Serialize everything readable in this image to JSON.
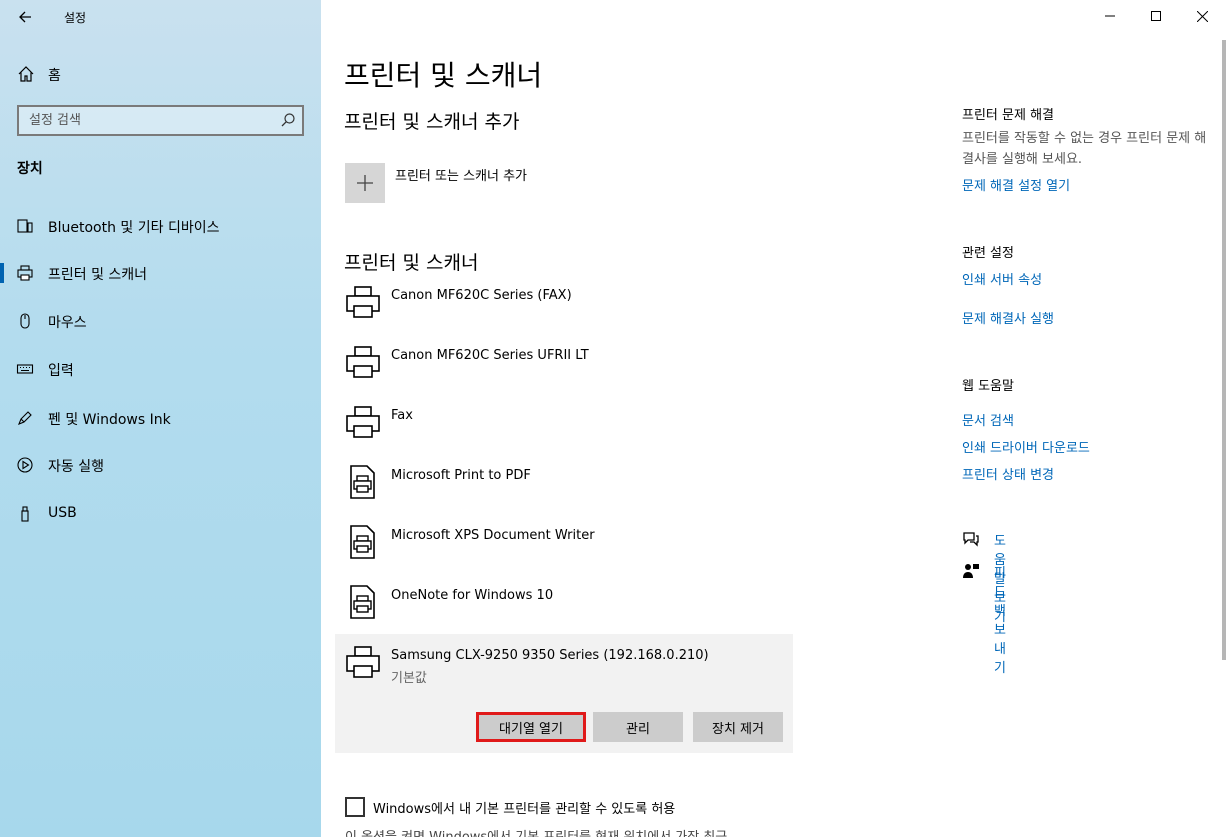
{
  "window": {
    "app_title": "설정",
    "back_icon": "←",
    "minimize_icon": "—",
    "maximize_icon": "☐",
    "close_icon": "✕"
  },
  "sidebar": {
    "home_label": "홈",
    "search_placeholder": "설정 검색",
    "section_label": "장치",
    "items": [
      {
        "label": "Bluetooth 및 기타 디바이스",
        "icon": "bluetooth-devices-icon"
      },
      {
        "label": "프린터 및 스캐너",
        "icon": "printer-icon",
        "selected": true
      },
      {
        "label": "마우스",
        "icon": "mouse-icon"
      },
      {
        "label": "입력",
        "icon": "keyboard-icon"
      },
      {
        "label": "펜 및 Windows Ink",
        "icon": "pen-icon"
      },
      {
        "label": "자동 실행",
        "icon": "autoplay-icon"
      },
      {
        "label": "USB",
        "icon": "usb-icon"
      }
    ],
    "accent_color": "#0063b1"
  },
  "main": {
    "title": "프린터 및 스캐너",
    "add_section_title": "프린터 및 스캐너 추가",
    "add_button_label": "프린터 또는 스캐너 추가",
    "list_section_title": "프린터 및 스캐너",
    "printers": [
      {
        "name": "Canon MF620C Series (FAX)",
        "icon": "printer-icon"
      },
      {
        "name": "Canon MF620C Series UFRII LT",
        "icon": "printer-icon"
      },
      {
        "name": "Fax",
        "icon": "printer-icon"
      },
      {
        "name": "Microsoft Print to PDF",
        "icon": "printer-document-icon"
      },
      {
        "name": "Microsoft XPS Document Writer",
        "icon": "printer-document-icon"
      },
      {
        "name": "OneNote for Windows 10",
        "icon": "printer-document-icon"
      }
    ],
    "selected_printer": {
      "name": "Samsung CLX-9250 9350 Series (192.168.0.210)",
      "status": "기본값",
      "buttons": {
        "open_queue": "대기열 열기",
        "manage": "관리",
        "remove": "장치 제거"
      }
    },
    "default_checkbox_label": "Windows에서 내 기본 프린터를 관리할 수 있도록 허용",
    "default_checkbox_checked": false,
    "cut_description": "이 옵션을 켜면 Windows에서 기본 프린터를 현재 위치에서 가장 최근"
  },
  "rail": {
    "troubleshoot_title": "프린터 문제 해결",
    "troubleshoot_desc": "프린터를 작동할 수 없는 경우 프린터 문제 해결사를 실행해 보세요.",
    "troubleshoot_link": "문제 해결 설정 열기",
    "related_title": "관련 설정",
    "related_links": [
      "인쇄 서버 속성",
      "문제 해결사 실행"
    ],
    "web_help_title": "웹 도움말",
    "web_help_links": [
      "문서 검색",
      "인쇄 드라이버 다운로드",
      "프린터 상태 변경"
    ],
    "get_help": "도움말 보기",
    "feedback": "피드백 보내기",
    "link_color": "#0067b8"
  }
}
